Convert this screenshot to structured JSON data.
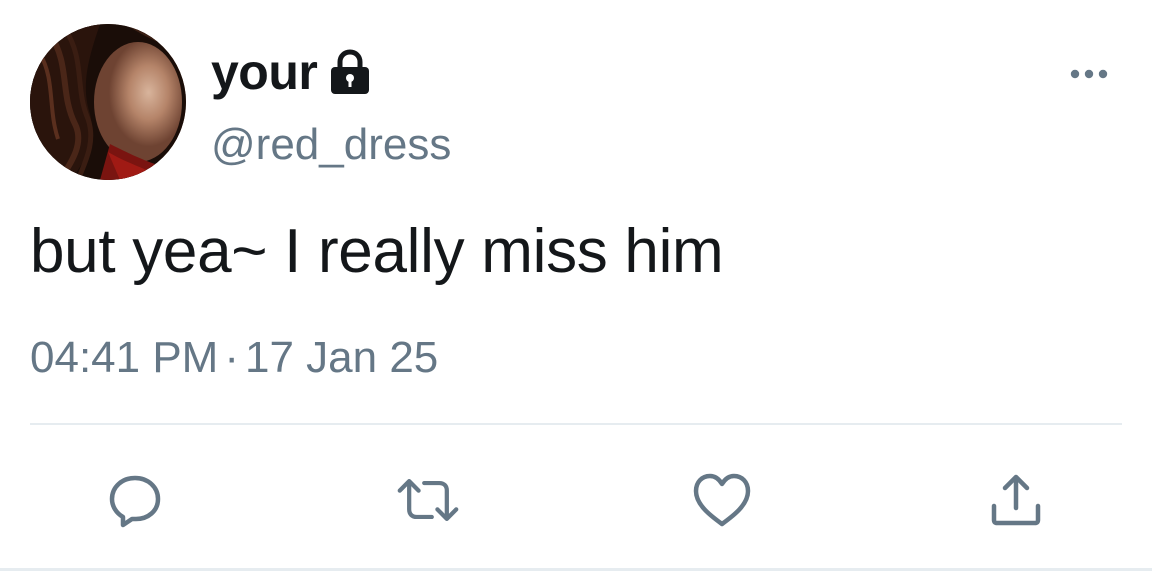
{
  "user": {
    "display_name": "your",
    "handle": "@red_dress",
    "protected_icon": "lock-icon",
    "avatar": "profile-photo"
  },
  "tweet": {
    "text": "but yea~ I really miss him",
    "time": "04:41 PM",
    "separator": "·",
    "date": "17 Jan 25"
  },
  "actions": [
    {
      "name": "reply",
      "icon": "reply-icon"
    },
    {
      "name": "retweet",
      "icon": "retweet-icon"
    },
    {
      "name": "like",
      "icon": "heart-icon"
    },
    {
      "name": "share",
      "icon": "share-icon"
    }
  ],
  "colors": {
    "text_primary": "#14171a",
    "text_secondary": "#657786",
    "divider": "#e6ecf0"
  }
}
